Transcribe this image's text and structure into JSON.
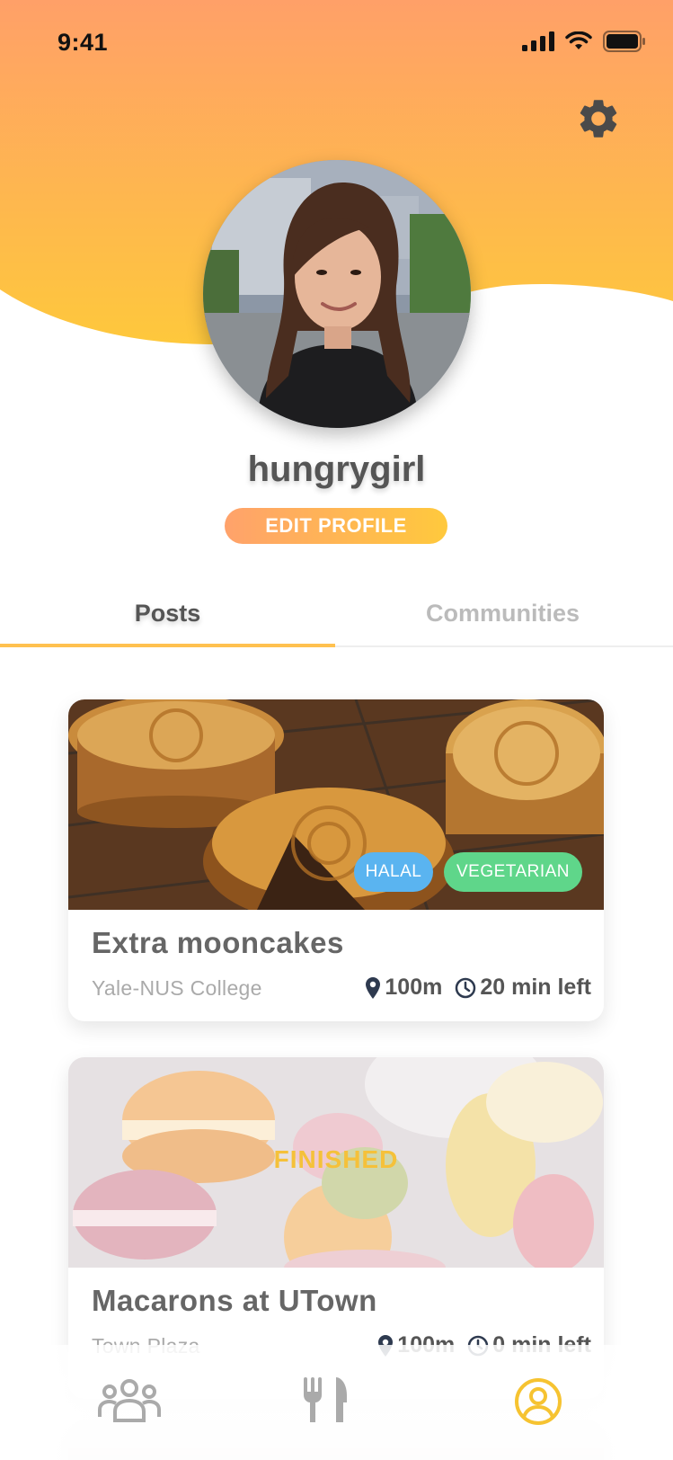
{
  "status_bar": {
    "time": "9:41"
  },
  "profile": {
    "username": "hungrygirl",
    "edit_profile_label": "EDIT PROFILE"
  },
  "tabs": [
    {
      "label": "Posts",
      "active": true
    },
    {
      "label": "Communities",
      "active": false
    }
  ],
  "posts": [
    {
      "title": "Extra mooncakes",
      "location": "Yale-NUS College",
      "distance": "100m",
      "time_left": "20 min left",
      "tags": [
        "HALAL",
        "VEGETARIAN"
      ],
      "finished": false
    },
    {
      "title": "Macarons at UTown",
      "location": "Town Plaza",
      "distance": "100m",
      "time_left": "0 min left",
      "status_label": "FINISHED",
      "finished": true
    }
  ],
  "bottom_nav": [
    {
      "icon": "communities-icon",
      "active": false
    },
    {
      "icon": "utensils-icon",
      "active": false
    },
    {
      "icon": "profile-icon",
      "active": true
    }
  ],
  "colors": {
    "gradient_top": "#ffa068",
    "gradient_bottom": "#fec83c",
    "accent": "#ffc14f",
    "halal": "#5ab4f0",
    "vegetarian": "#5fd68a",
    "finished": "#f5c13a"
  }
}
